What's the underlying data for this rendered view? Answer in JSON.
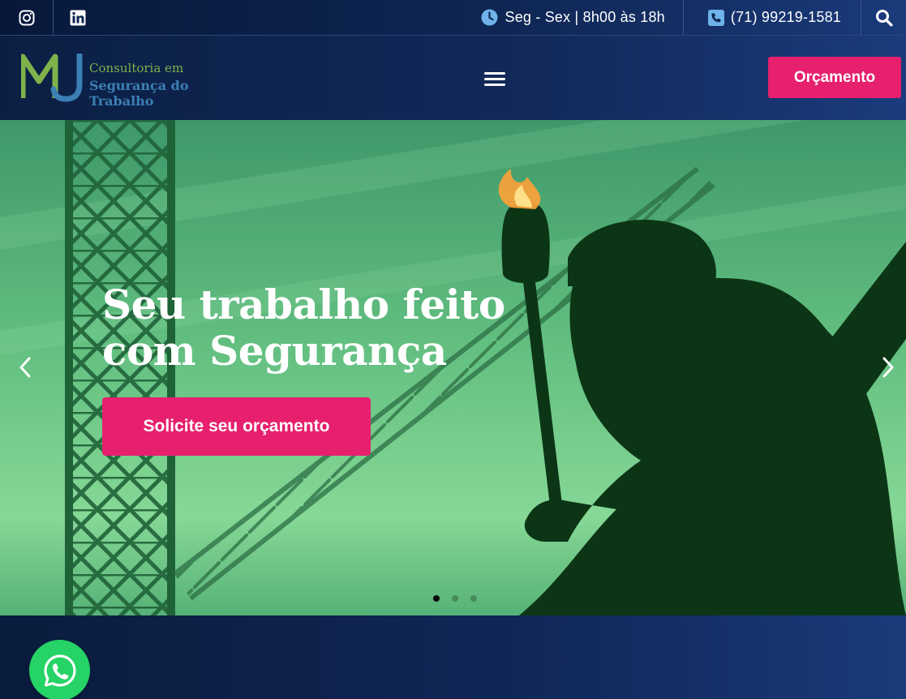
{
  "topbar": {
    "hours": "Seg - Sex | 8h00 às 18h",
    "phone": "(71) 99219-1581",
    "icons": [
      "instagram-icon",
      "linkedin-icon",
      "clock-icon",
      "phone-icon",
      "search-icon"
    ]
  },
  "header": {
    "logo_mark": "MJ",
    "logo_line1": "Consultoria em",
    "logo_line2": "Segurança do Trabalho",
    "quote_button": "Orçamento"
  },
  "hero": {
    "title_line1": "Seu trabalho feito",
    "title_line2": "com Segurança",
    "cta": "Solicite seu orçamento",
    "slides_total": 3,
    "active_slide": 1
  },
  "colors": {
    "accent": "#e6206e",
    "navy": "#0f2653",
    "logo_green": "#7fb24a",
    "logo_blue": "#3c7fb4",
    "whatsapp": "#25d366"
  }
}
